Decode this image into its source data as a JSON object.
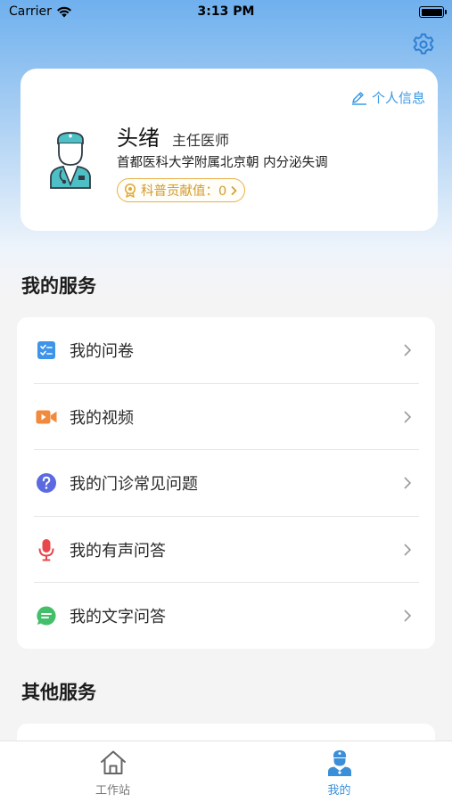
{
  "status_bar": {
    "carrier": "Carrier",
    "time": "3:13 PM"
  },
  "profile": {
    "edit_label": "个人信息",
    "name": "头绪",
    "title": "主任医师",
    "hospital": "首都医科大学附属北京朝 内分泌失调",
    "contribution": "科普贡献值：0"
  },
  "my_services": {
    "title": "我的服务",
    "items": [
      {
        "label": "我的问卷",
        "icon": "questionnaire-icon",
        "color": "#3d94e8"
      },
      {
        "label": "我的视频",
        "icon": "video-icon",
        "color": "#f18a3c"
      },
      {
        "label": "我的门诊常见问题",
        "icon": "question-icon",
        "color": "#5b6ae0"
      },
      {
        "label": "我的有声问答",
        "icon": "microphone-icon",
        "color": "#e8474c"
      },
      {
        "label": "我的文字问答",
        "icon": "chat-icon",
        "color": "#45be6a"
      }
    ]
  },
  "other_services": {
    "title": "其他服务"
  },
  "tabs": [
    {
      "label": "工作站",
      "icon": "home-icon",
      "active": false
    },
    {
      "label": "我的",
      "icon": "doctor-icon",
      "active": true
    }
  ],
  "colors": {
    "accent": "#3b8fd9",
    "badge": "#e8b045"
  }
}
